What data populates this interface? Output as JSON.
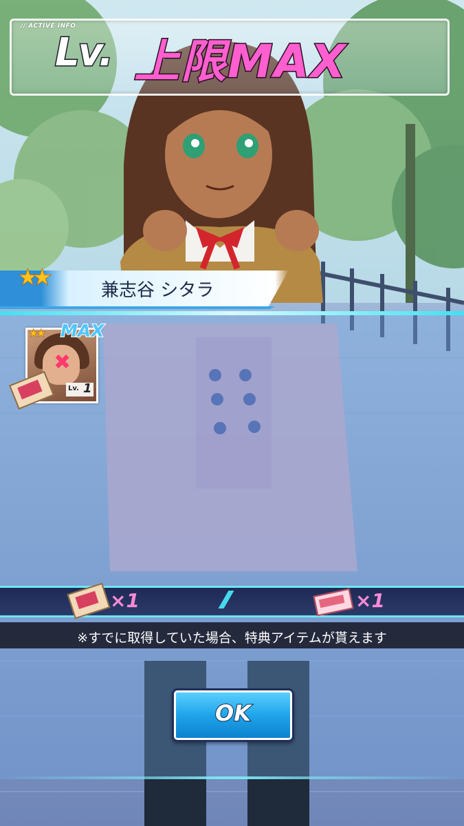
{
  "header": {
    "tag": "// ACTIVE INFO",
    "lv": "Lv.",
    "title": "上限MAX"
  },
  "character": {
    "rarity_stars": 2,
    "name": "兼志谷 シタラ"
  },
  "card": {
    "badge": "MAX",
    "level_label": "Lv.",
    "level_value": "1"
  },
  "rewards": [
    {
      "item_icon": "beef-item-icon",
      "quantity": "×1"
    },
    {
      "item_icon": "ticket-item-icon",
      "quantity": "×1"
    }
  ],
  "notice": "※すでに取得していた場合、特典アイテムが貰えます",
  "ok_button": {
    "label": "OK"
  },
  "colors": {
    "title_pink": "#ff5fcf",
    "accent_cyan": "#6fe7f2",
    "button_blue": "#20a4ea",
    "star_gold": "#ffc21a"
  }
}
